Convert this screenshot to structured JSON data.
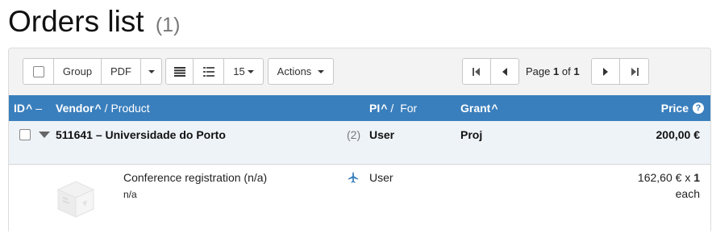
{
  "title": {
    "text": "Orders list",
    "count": "(1)"
  },
  "toolbar": {
    "group_label": "Group",
    "pdf_label": "PDF",
    "page_size": "15",
    "actions_label": "Actions",
    "pager": {
      "prefix": "Page",
      "current": "1",
      "of": "of",
      "total": "1"
    }
  },
  "table": {
    "headers": {
      "id": "ID",
      "id_sort": "^",
      "id_sep": "–",
      "vendor": "Vendor",
      "vendor_sort": "^",
      "vendor_sep": "/",
      "product": "Product",
      "pi": "PI",
      "pi_sort": "^",
      "pi_sep": "/",
      "for": "For",
      "grant": "Grant",
      "grant_sort": "^",
      "price": "Price"
    },
    "group": {
      "label": "511641 – Universidade do Porto",
      "count": "(2)",
      "pi": "User",
      "grant": "Proj",
      "price": "200,00 €"
    },
    "items": [
      {
        "product": "Conference registration (n/a)",
        "detail": "n/a",
        "user": "User",
        "unit_price": "162,60 €",
        "times": "x",
        "quantity": "1",
        "unit": "each",
        "thumb_icon": "package-placeholder-icon",
        "for_icon": "plane-icon"
      }
    ]
  },
  "colors": {
    "header_bg": "#3a7fbd",
    "group_bg": "#eef3f8",
    "panel_bg": "#f3f3f3"
  }
}
